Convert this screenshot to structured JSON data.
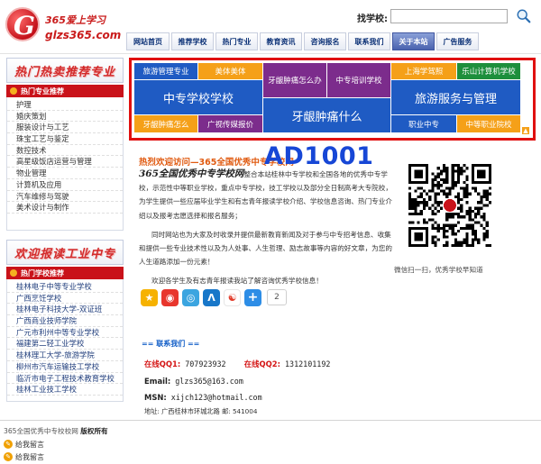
{
  "header": {
    "logo_mark": "G",
    "logo_cn": "365爱上学习",
    "logo_en": "glzs365.com",
    "search_label": "找学校:",
    "search_value": "",
    "search_icon": "search-icon"
  },
  "nav": {
    "items": [
      {
        "label": "网站首页",
        "active": false
      },
      {
        "label": "推荐学校",
        "active": false
      },
      {
        "label": "热门专业",
        "active": false
      },
      {
        "label": "教育资讯",
        "active": false
      },
      {
        "label": "咨询报名",
        "active": false
      },
      {
        "label": "联系我们",
        "active": false
      },
      {
        "label": "关于本站",
        "active": true
      },
      {
        "label": "广告服务",
        "active": false
      }
    ]
  },
  "sidebar": {
    "banner1": "热门热卖推荐专业",
    "section1_title": "热门专业推荐",
    "majors": [
      "护理",
      "婚庆策划",
      "服装设计与工艺",
      "珠宝工艺与鉴定",
      "数控技术",
      "高星级饭店运营与管理",
      "物业管理",
      "计算机及应用",
      "汽车维修与驾驶",
      "美术设计与制作"
    ],
    "banner2": "欢迎报读工业中专",
    "section2_title": "热门学校推荐",
    "schools": [
      "桂林电子中等专业学校",
      "广西烹饪学校",
      "桂林电子科技大学-双证班",
      "广西商业技师学院",
      "广元市利州中等专业学校",
      "福建第二轻工业学校",
      "桂林理工大学-旅游学院",
      "柳州市汽车运输技工学校",
      "临沂市电子工程技术教育学校",
      "桂林工业技工学校"
    ]
  },
  "ad_grid": {
    "cells": [
      "旅游管理专业",
      "美体美体",
      "牙龈肿痛怎么办",
      "中专培训学校",
      "上海学驾照",
      "乐山计算机学校",
      "中专学校学校",
      "旅游服务与管理",
      "牙龈肿痛什么",
      "牙龈肿痛怎么",
      "广视传媒报价",
      "职业中专",
      "中等职业院校"
    ],
    "corner_icon": "arrow-icon",
    "ad_code": "AD1001"
  },
  "main": {
    "welcome": "热烈欢迎访问—365全国优秀中专学校网",
    "brand": "365全国优秀中专学校网",
    "intro_rest": "整合本站桂林中专学校和全国各地的优秀中专学校，示范性中等职业学校，重点中专学校，技工学校以及部分全日制高考大专院校，为学生提供一些应届毕业学生和有志青年报读学校介绍、学校信息咨询、热门专业介绍以及报考志愿选择和报名服务；",
    "intro_p2": "同时网站也为大家及时收录并提供最新教育新闻及对于参与中专招考信息、收集和提供一些专业技术性以及为人处事、人生哲理、励志故事等内容的好文章，为您的人生道路添加一份元素！",
    "intro_p3": "欢迎各学生及有志青年报读我站了解咨询优秀学校信息！",
    "qr_caption": "微信扫一扫，优秀学校早知道",
    "share": {
      "icons": [
        "qzone-icon",
        "weibo-icon",
        "tencent-weibo-icon",
        "renren-icon",
        "qq-weibo-icon",
        "plus-icon"
      ],
      "count": "2"
    },
    "contact": {
      "title": "== 联系我们 ==",
      "qq1_label": "在线QQ1:",
      "qq1": "707923932",
      "qq2_label": "在线QQ2:",
      "qq2": "1312101192",
      "email_label": "Email:",
      "email": "glzs365@163.com",
      "msn_label": "MSN:",
      "msn": "xijch123@hotmail.com",
      "address_label": "地址:",
      "address": "广西桂林市环城北路 邮: 541004"
    }
  },
  "footer": {
    "copyright": "365全国优秀中专校校网",
    "rights": "版权所有",
    "msg_btn_1": "给我留言",
    "msg_btn_2": "给我留言"
  },
  "colors": {
    "accent_red": "#c9121a",
    "nav_blue": "#0e3378",
    "ad_code_blue": "#1747d6"
  }
}
